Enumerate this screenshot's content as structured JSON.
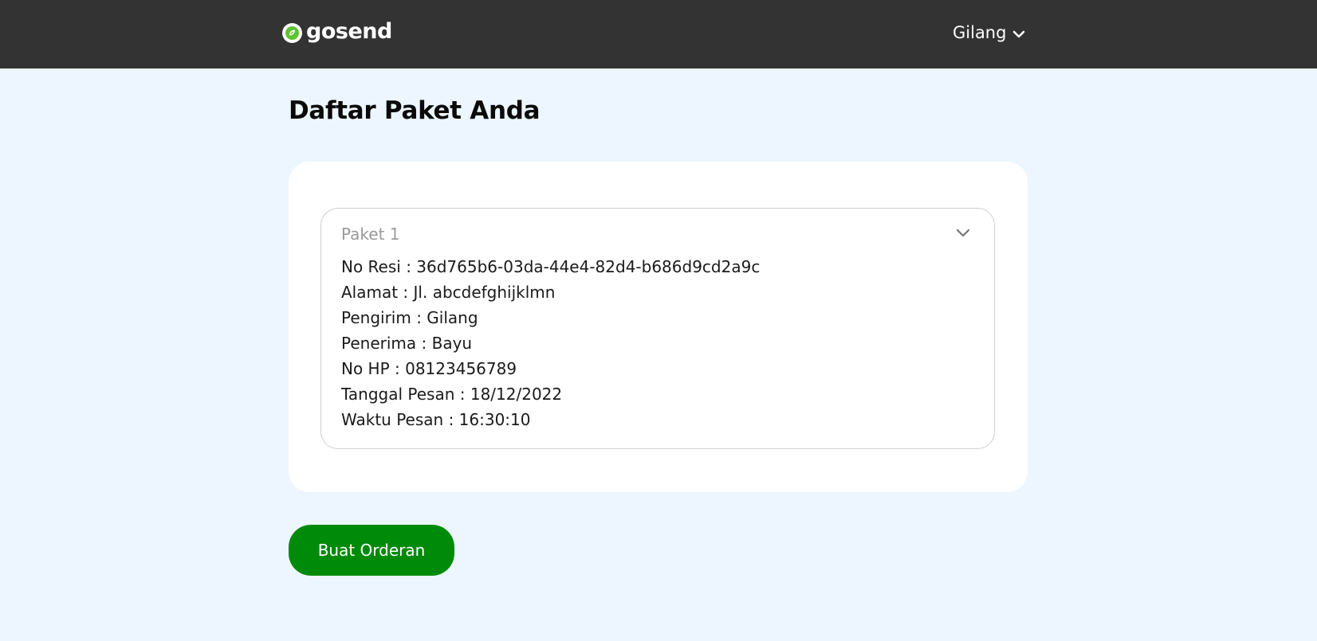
{
  "header": {
    "logo_text": "gosend",
    "user_name": "Gilang",
    "icons": {
      "logo": "gosend-logo-icon",
      "user_dropdown": "chevron-down-icon"
    }
  },
  "main": {
    "title": "Daftar Paket Anda",
    "packages": [
      {
        "title": "Paket 1",
        "expanded": true,
        "details": [
          "No Resi : 36d765b6-03da-44e4-82d4-b686d9cd2a9c",
          "Alamat : Jl. abcdefghijklmn",
          "Pengirim : Gilang",
          "Penerima : Bayu",
          "No HP : 08123456789",
          "Tanggal Pesan : 18/12/2022",
          "Waktu Pesan : 16:30:10"
        ]
      }
    ],
    "order_button_label": "Buat Orderan"
  },
  "colors": {
    "navbar": "#333333",
    "page_background": "#edf6fe",
    "accent_green": "#008a0a",
    "logo_green": "#5cc431"
  }
}
